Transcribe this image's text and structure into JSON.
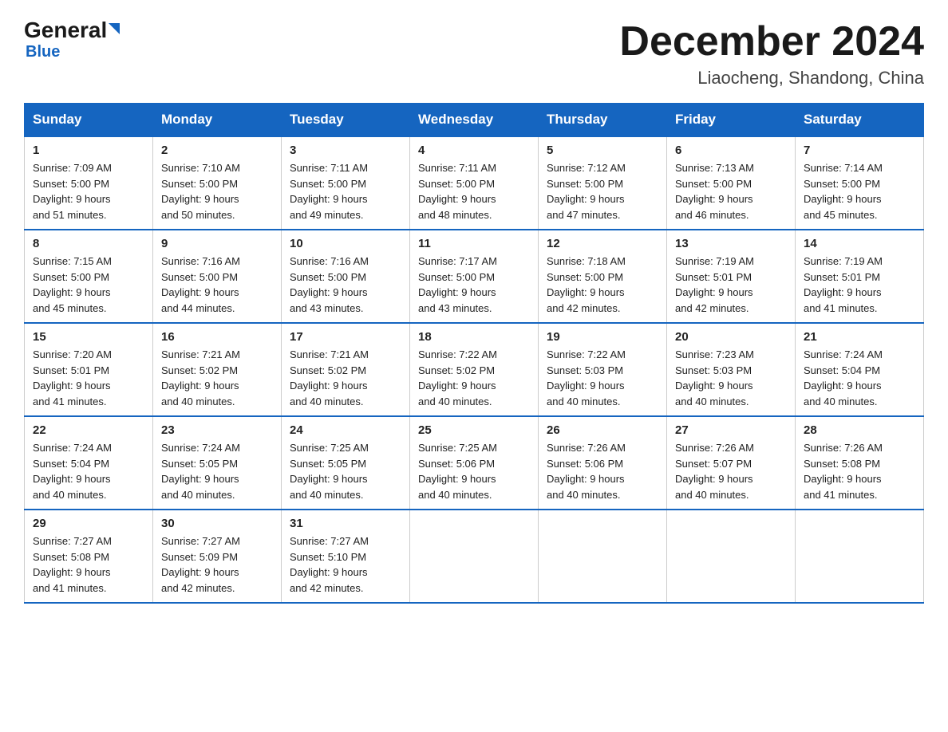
{
  "header": {
    "logo_general": "General",
    "logo_blue": "Blue",
    "month_title": "December 2024",
    "location": "Liaocheng, Shandong, China"
  },
  "weekdays": [
    "Sunday",
    "Monday",
    "Tuesday",
    "Wednesday",
    "Thursday",
    "Friday",
    "Saturday"
  ],
  "weeks": [
    [
      {
        "day": "1",
        "sunrise": "7:09 AM",
        "sunset": "5:00 PM",
        "daylight": "9 hours and 51 minutes."
      },
      {
        "day": "2",
        "sunrise": "7:10 AM",
        "sunset": "5:00 PM",
        "daylight": "9 hours and 50 minutes."
      },
      {
        "day": "3",
        "sunrise": "7:11 AM",
        "sunset": "5:00 PM",
        "daylight": "9 hours and 49 minutes."
      },
      {
        "day": "4",
        "sunrise": "7:11 AM",
        "sunset": "5:00 PM",
        "daylight": "9 hours and 48 minutes."
      },
      {
        "day": "5",
        "sunrise": "7:12 AM",
        "sunset": "5:00 PM",
        "daylight": "9 hours and 47 minutes."
      },
      {
        "day": "6",
        "sunrise": "7:13 AM",
        "sunset": "5:00 PM",
        "daylight": "9 hours and 46 minutes."
      },
      {
        "day": "7",
        "sunrise": "7:14 AM",
        "sunset": "5:00 PM",
        "daylight": "9 hours and 45 minutes."
      }
    ],
    [
      {
        "day": "8",
        "sunrise": "7:15 AM",
        "sunset": "5:00 PM",
        "daylight": "9 hours and 45 minutes."
      },
      {
        "day": "9",
        "sunrise": "7:16 AM",
        "sunset": "5:00 PM",
        "daylight": "9 hours and 44 minutes."
      },
      {
        "day": "10",
        "sunrise": "7:16 AM",
        "sunset": "5:00 PM",
        "daylight": "9 hours and 43 minutes."
      },
      {
        "day": "11",
        "sunrise": "7:17 AM",
        "sunset": "5:00 PM",
        "daylight": "9 hours and 43 minutes."
      },
      {
        "day": "12",
        "sunrise": "7:18 AM",
        "sunset": "5:00 PM",
        "daylight": "9 hours and 42 minutes."
      },
      {
        "day": "13",
        "sunrise": "7:19 AM",
        "sunset": "5:01 PM",
        "daylight": "9 hours and 42 minutes."
      },
      {
        "day": "14",
        "sunrise": "7:19 AM",
        "sunset": "5:01 PM",
        "daylight": "9 hours and 41 minutes."
      }
    ],
    [
      {
        "day": "15",
        "sunrise": "7:20 AM",
        "sunset": "5:01 PM",
        "daylight": "9 hours and 41 minutes."
      },
      {
        "day": "16",
        "sunrise": "7:21 AM",
        "sunset": "5:02 PM",
        "daylight": "9 hours and 40 minutes."
      },
      {
        "day": "17",
        "sunrise": "7:21 AM",
        "sunset": "5:02 PM",
        "daylight": "9 hours and 40 minutes."
      },
      {
        "day": "18",
        "sunrise": "7:22 AM",
        "sunset": "5:02 PM",
        "daylight": "9 hours and 40 minutes."
      },
      {
        "day": "19",
        "sunrise": "7:22 AM",
        "sunset": "5:03 PM",
        "daylight": "9 hours and 40 minutes."
      },
      {
        "day": "20",
        "sunrise": "7:23 AM",
        "sunset": "5:03 PM",
        "daylight": "9 hours and 40 minutes."
      },
      {
        "day": "21",
        "sunrise": "7:24 AM",
        "sunset": "5:04 PM",
        "daylight": "9 hours and 40 minutes."
      }
    ],
    [
      {
        "day": "22",
        "sunrise": "7:24 AM",
        "sunset": "5:04 PM",
        "daylight": "9 hours and 40 minutes."
      },
      {
        "day": "23",
        "sunrise": "7:24 AM",
        "sunset": "5:05 PM",
        "daylight": "9 hours and 40 minutes."
      },
      {
        "day": "24",
        "sunrise": "7:25 AM",
        "sunset": "5:05 PM",
        "daylight": "9 hours and 40 minutes."
      },
      {
        "day": "25",
        "sunrise": "7:25 AM",
        "sunset": "5:06 PM",
        "daylight": "9 hours and 40 minutes."
      },
      {
        "day": "26",
        "sunrise": "7:26 AM",
        "sunset": "5:06 PM",
        "daylight": "9 hours and 40 minutes."
      },
      {
        "day": "27",
        "sunrise": "7:26 AM",
        "sunset": "5:07 PM",
        "daylight": "9 hours and 40 minutes."
      },
      {
        "day": "28",
        "sunrise": "7:26 AM",
        "sunset": "5:08 PM",
        "daylight": "9 hours and 41 minutes."
      }
    ],
    [
      {
        "day": "29",
        "sunrise": "7:27 AM",
        "sunset": "5:08 PM",
        "daylight": "9 hours and 41 minutes."
      },
      {
        "day": "30",
        "sunrise": "7:27 AM",
        "sunset": "5:09 PM",
        "daylight": "9 hours and 42 minutes."
      },
      {
        "day": "31",
        "sunrise": "7:27 AM",
        "sunset": "5:10 PM",
        "daylight": "9 hours and 42 minutes."
      },
      null,
      null,
      null,
      null
    ]
  ],
  "labels": {
    "sunrise_prefix": "Sunrise: ",
    "sunset_prefix": "Sunset: ",
    "daylight_prefix": "Daylight: "
  }
}
